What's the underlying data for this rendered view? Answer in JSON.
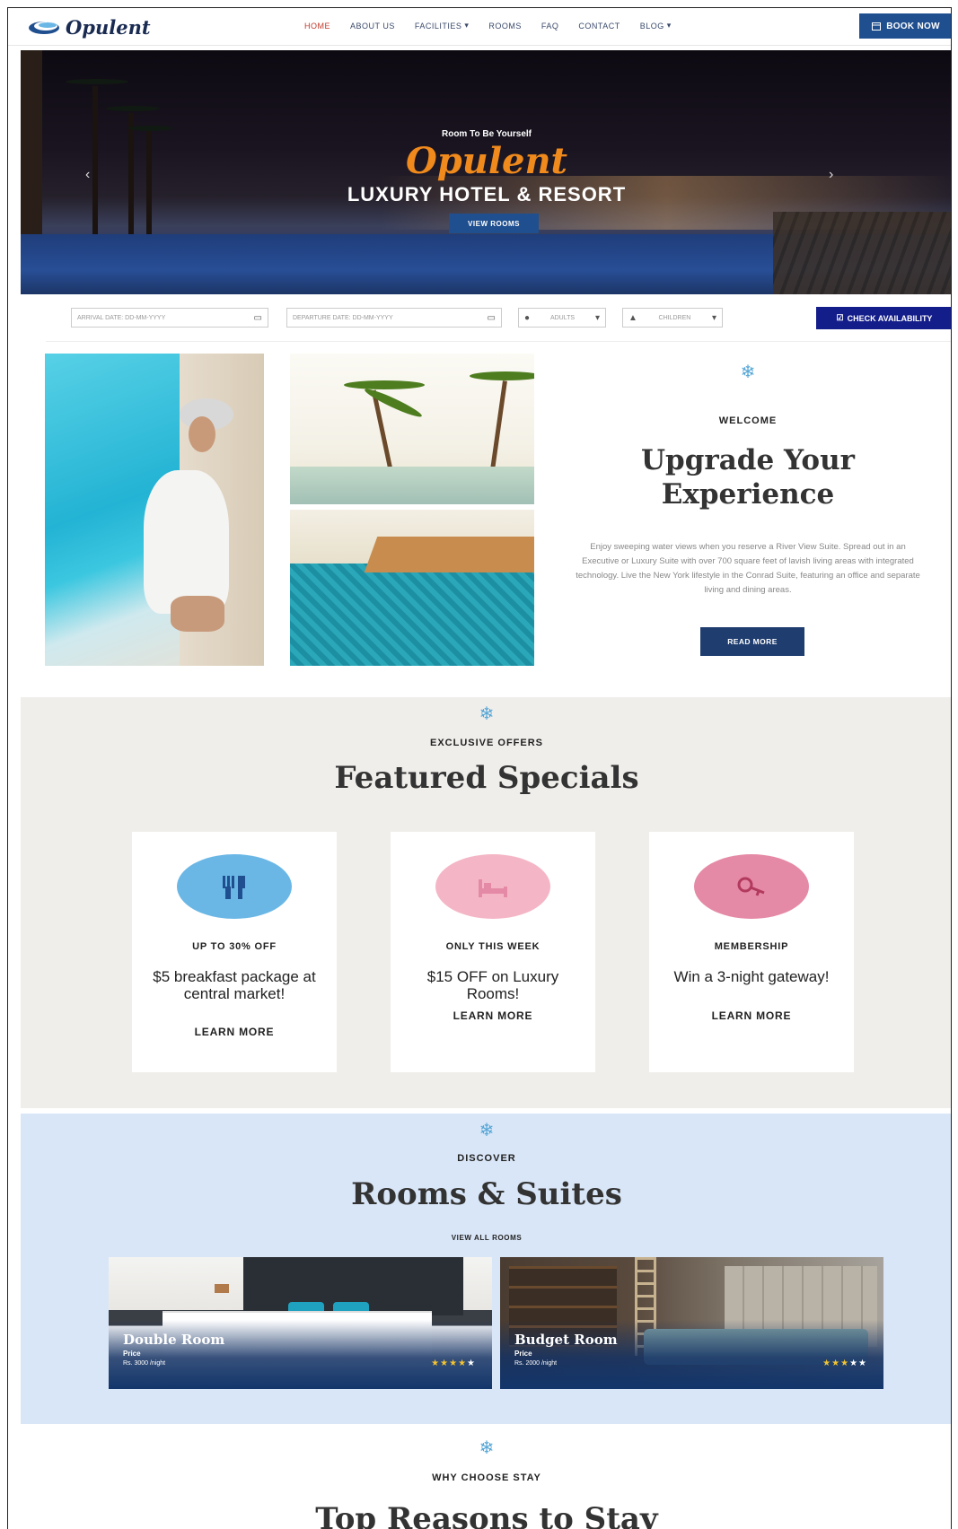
{
  "header": {
    "logo_text": "Opulent",
    "nav": [
      {
        "label": "HOME",
        "active": true,
        "has_dropdown": false
      },
      {
        "label": "ABOUT US",
        "active": false,
        "has_dropdown": false
      },
      {
        "label": "FACILITIES",
        "active": false,
        "has_dropdown": true
      },
      {
        "label": "ROOMS",
        "active": false,
        "has_dropdown": false
      },
      {
        "label": "FAQ",
        "active": false,
        "has_dropdown": false
      },
      {
        "label": "CONTACT",
        "active": false,
        "has_dropdown": false
      },
      {
        "label": "BLOG",
        "active": false,
        "has_dropdown": true
      }
    ],
    "book_label": "BOOK NOW",
    "book_icon": "calendar-icon"
  },
  "hero": {
    "tagline": "Room To Be Yourself",
    "script_title": "Opulent",
    "title": "LUXURY HOTEL & RESORT",
    "button_label": "VIEW ROOMS",
    "prev_arrow": "‹",
    "next_arrow": "›"
  },
  "booking": {
    "arrival_placeholder": "ARRIVAL DATE: DD-MM-YYYY",
    "departure_placeholder": "DEPARTURE DATE: DD-MM-YYYY",
    "adults_placeholder": "ADULTS",
    "children_placeholder": "CHILDREN",
    "check_label": "CHECK AVAILABILITY"
  },
  "welcome": {
    "eyebrow": "WELCOME",
    "title": "Upgrade Your Experience",
    "body": "Enjoy sweeping water views when you reserve a River View Suite. Spread out in an Executive or Luxury Suite with over 700 square feet of lavish living areas with integrated technology. Live the New York lifestyle in the Conrad Suite, featuring an office and separate living and dining areas.",
    "button_label": "READ MORE"
  },
  "offers": {
    "eyebrow": "EXCLUSIVE OFFERS",
    "title": "Featured Specials",
    "cards": [
      {
        "tag": "UP TO 30% OFF",
        "desc": "$5 breakfast package at central market!",
        "learn": "LEARN MORE",
        "icon": "utensils-icon",
        "color": "#6ab7e6"
      },
      {
        "tag": "ONLY THIS WEEK",
        "desc": "$15 OFF on Luxury Rooms!",
        "learn": "LEARN MORE",
        "icon": "bed-icon",
        "color": "#f4b6c6"
      },
      {
        "tag": "MEMBERSHIP",
        "desc": "Win a 3-night gateway!",
        "learn": "LEARN MORE",
        "icon": "key-icon",
        "color": "#e58aa6"
      }
    ]
  },
  "rooms": {
    "eyebrow": "DISCOVER",
    "title": "Rooms & Suites",
    "view_all": "VIEW ALL ROOMS",
    "cards": [
      {
        "name": "Double Room",
        "price_label": "Price",
        "price": "Rs. 3000 /night",
        "rating": 4,
        "max": 5
      },
      {
        "name": "Budget Room",
        "price_label": "Price",
        "price": "Rs. 2000 /night",
        "rating": 3,
        "max": 5
      }
    ]
  },
  "why": {
    "eyebrow": "WHY CHOOSE STAY",
    "title": "Top Reasons to Stay"
  },
  "colors": {
    "brand_navy": "#1f3d6f",
    "accent_orange": "#f08a1c",
    "check_blue": "#141e8a",
    "offers_bg": "#f0eeeb",
    "rooms_bg": "#d9e6f7",
    "snowflake_blue": "#55a6d6"
  },
  "decor": {
    "snowflake": "❄",
    "star_on": "★",
    "star_off": "★"
  }
}
